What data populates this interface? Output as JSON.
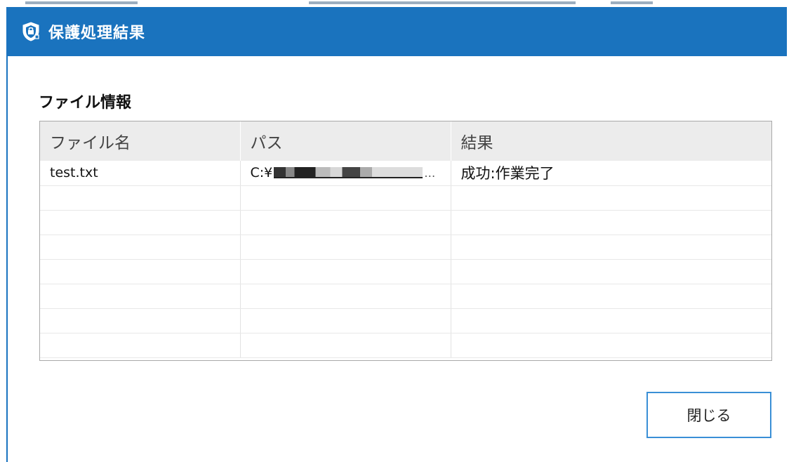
{
  "window": {
    "title": "保護処理結果",
    "title_icon": "shield-lock-icon",
    "accent_color": "#1a73be"
  },
  "section": {
    "title": "ファイル情報"
  },
  "table": {
    "columns": [
      "ファイル名",
      "パス",
      "結果"
    ],
    "rows": [
      {
        "file_name": "test.txt",
        "path": "C:¥",
        "path_redacted": true,
        "result": "成功:作業完了"
      }
    ],
    "empty_rows": 7
  },
  "buttons": {
    "close_label": "閉じる"
  }
}
